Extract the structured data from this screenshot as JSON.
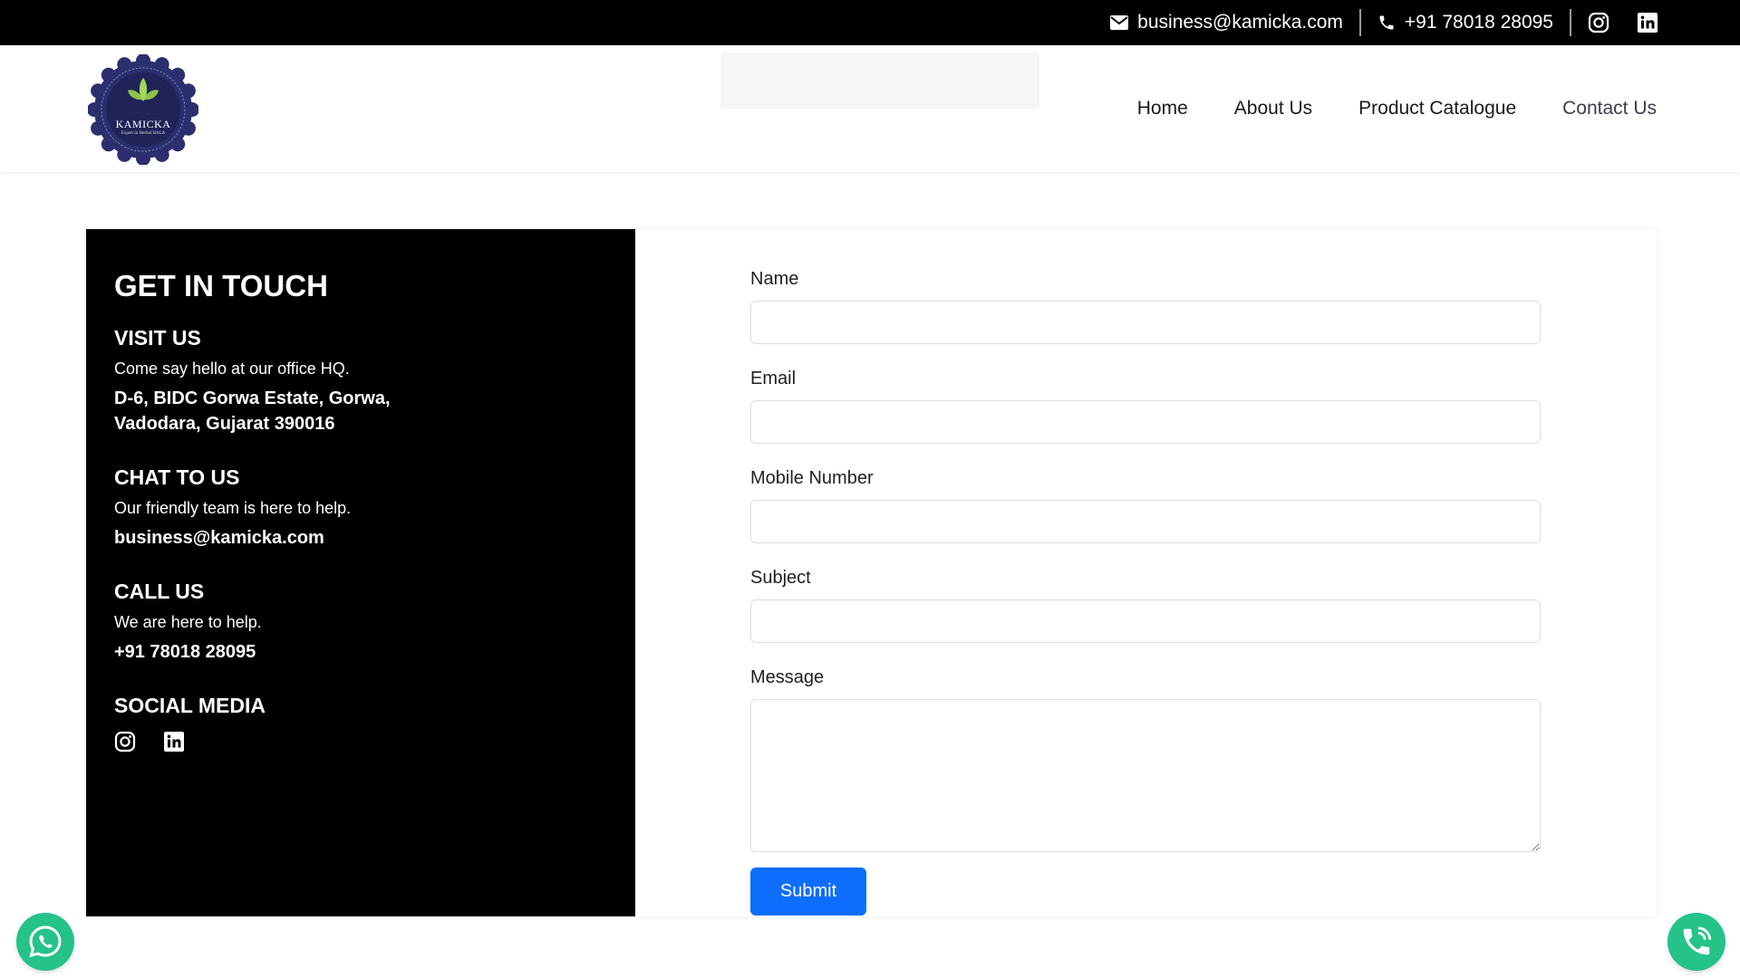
{
  "topbar": {
    "email": "business@kamicka.com",
    "phone": "+91 78018 28095",
    "icons": [
      "envelope-icon",
      "phone-icon",
      "instagram-icon",
      "linkedin-icon"
    ]
  },
  "brand": {
    "name": "KAMICKA",
    "tagline": "Expert in Herbal HALA",
    "colors": {
      "badge": "#2b2f6e",
      "leaf": "#8bc34a"
    }
  },
  "nav": {
    "items": [
      "Home",
      "About Us",
      "Product Catalogue",
      "Contact Us"
    ],
    "active": "Contact Us"
  },
  "contact": {
    "title": "GET IN TOUCH",
    "visit": {
      "heading": "VISIT US",
      "text": "Come say hello at our office HQ.",
      "address_line1": "D-6, BIDC Gorwa Estate, Gorwa,",
      "address_line2": "Vadodara, Gujarat 390016"
    },
    "chat": {
      "heading": "CHAT TO US",
      "text": "Our friendly team is here to help.",
      "email": "business@kamicka.com"
    },
    "call": {
      "heading": "CALL US",
      "text": "We are here to help.",
      "phone": "+91 78018 28095"
    },
    "social": {
      "heading": "SOCIAL MEDIA",
      "icons": [
        "instagram-icon",
        "linkedin-icon"
      ]
    }
  },
  "form": {
    "name_label": "Name",
    "name_value": "",
    "email_label": "Email",
    "email_value": "",
    "mobile_label": "Mobile Number",
    "mobile_value": "",
    "subject_label": "Subject",
    "subject_value": "",
    "message_label": "Message",
    "message_value": "",
    "submit_label": "Submit"
  },
  "floating": {
    "left_icon": "whatsapp-icon",
    "right_icon": "phone-call-icon",
    "color": "#25c28a"
  },
  "colors": {
    "accent": "#0d6efd",
    "topbar_bg": "#000000",
    "panel_bg": "#000000"
  }
}
